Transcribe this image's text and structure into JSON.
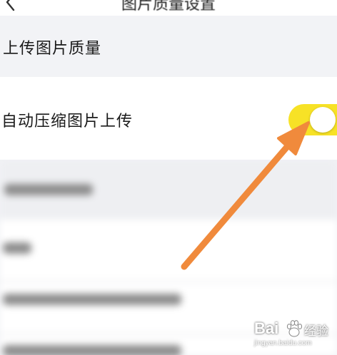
{
  "nav": {
    "title": "图片质量设置",
    "back_icon": "chevron-left-icon"
  },
  "section": {
    "title": "上传图片质量"
  },
  "settings": {
    "compress_label": "自动压缩图片上传",
    "compress_enabled": true,
    "toggle_color": "#f7e226"
  },
  "annotation": {
    "arrow_color": "#f08a3c",
    "arrow_icon": "pointer-arrow-icon"
  },
  "watermark": {
    "brand": "Bai",
    "paw_icon": "baidu-paw-icon",
    "cn": "经验",
    "sub": "jingyan.baidu.com"
  }
}
